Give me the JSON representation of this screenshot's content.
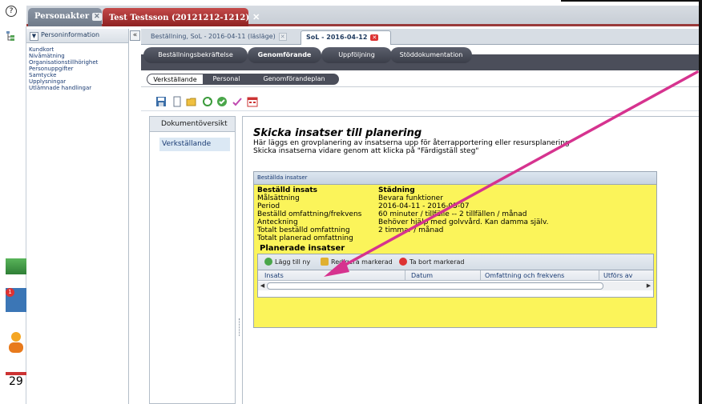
{
  "main_tabs": [
    {
      "label": "Personakter",
      "close": "✕"
    },
    {
      "label": "Test Testsson (20121212-1212)",
      "close": "✕"
    }
  ],
  "left_strip": {
    "help": "?",
    "badge": "1",
    "calendar_day": "29"
  },
  "person_panel": {
    "header": "Personinformation",
    "items": [
      "Kundkort",
      "Nivåmätning",
      "Organisationstillhörighet",
      "Personuppgifter",
      "Samtycke",
      "Upplysningar",
      "Utlämnade handlingar"
    ]
  },
  "sub_tabs": [
    {
      "label": "Beställning, SoL - 2016-04-11 (läsläge)",
      "close": "✕"
    },
    {
      "label": "SoL - 2016-04-12",
      "close": "✕"
    }
  ],
  "steps": [
    "Beställningsbekräftelse",
    "Genomförande",
    "Uppföljning",
    "Stöddokumentation"
  ],
  "substeps": [
    "Verkställande",
    "Personal",
    "Genomförandeplan"
  ],
  "doc_panel": {
    "title": "Dokumentöversikt",
    "item": "Verkställande"
  },
  "headline": "Skicka insatser till planering",
  "intro": [
    "Här läggs en grovplanering av insatserna upp för återrapportering eller resursplanering",
    "Skicka insatserna vidare genom att klicka på \"Färdigställ steg\""
  ],
  "order_box": {
    "header": "Beställda insatser",
    "rows": [
      {
        "label": "Beställd insats",
        "value": "Städning",
        "bold": true
      },
      {
        "label": "Målsättning",
        "value": "Bevara funktioner"
      },
      {
        "label": "Period",
        "value": "2016-04-11 - 2016-05-07"
      },
      {
        "label": "Beställd omfattning/frekvens",
        "value": "60 minuter / tillfälle -- 2 tillfällen / månad"
      },
      {
        "label": "Anteckning",
        "value": "Behöver hjälp med golvvård. Kan damma själv."
      },
      {
        "label": "Totalt beställd omfattning",
        "value": "2 timmar / månad"
      },
      {
        "label": "Totalt planerad omfattning",
        "value": ""
      }
    ],
    "planned_title": "Planerade insatser",
    "buttons": [
      "Lägg till ny",
      "Redigera markerad",
      "Ta bort markerad"
    ],
    "columns": [
      "Insats",
      "Datum",
      "Omfattning och frekvens",
      "Utförs av"
    ]
  },
  "colors": {
    "order_bg": "#fbf45a",
    "arrow": "#d6338f",
    "step_band": "#4b4e5a",
    "active_tab": "#a43131"
  }
}
